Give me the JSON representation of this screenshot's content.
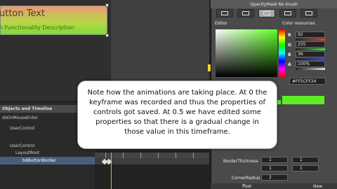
{
  "artboard": {
    "button_title": "utton Text",
    "button_description": "n Functionality Description"
  },
  "objects_panel": {
    "header": "Objects and Timeline",
    "storyboard": "sbOnMouseEnter",
    "tree": [
      {
        "label": "UserControl"
      },
      {
        "label": "UserControl"
      },
      {
        "label": "LayoutRoot"
      },
      {
        "label": "bdButtonBorder"
      }
    ]
  },
  "properties_panel": {
    "title": "OpacityMask  No brush",
    "editor_label": "Editor",
    "resources_label": "Color resources",
    "channels": [
      {
        "name": "R",
        "value": "92",
        "color": "#d44"
      },
      {
        "name": "G",
        "value": "255",
        "color": "#4d4"
      },
      {
        "name": "B",
        "value": "36",
        "color": "#44d"
      },
      {
        "name": "A",
        "value": "100%",
        "color": "#ddd"
      }
    ],
    "hex_value": "#FF5CFF24",
    "border_thickness_label": "BorderThickness",
    "border_values": [
      "1",
      "1",
      "1",
      "1"
    ],
    "corner_radius_label": "CornerRadius",
    "corner_radius_value": "2",
    "bottom_tabs": [
      "ffset",
      "New"
    ]
  },
  "callout": {
    "text": "Note how the animations are taking place. At 0 the keyframe was recorded and thus the properties of controls got saved. At 0.5 we have edited some properties so that there is a gradual change in those value in this timeframe."
  },
  "colors": {
    "accent_green": "#5cf024",
    "selection_blue": "#4a5e7c",
    "playhead": "#d4b23a"
  }
}
